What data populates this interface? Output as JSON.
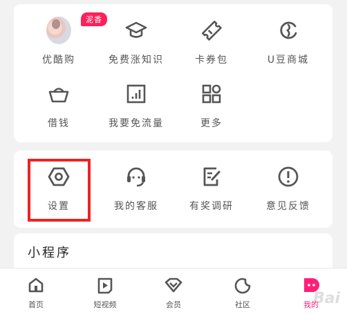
{
  "services": {
    "badge": "泥香",
    "items": [
      {
        "label": "优酷购",
        "icon": "avatar-image"
      },
      {
        "label": "免费涨知识",
        "icon": "graduation-cap-icon"
      },
      {
        "label": "卡券包",
        "icon": "ticket-icon"
      },
      {
        "label": "U豆商城",
        "icon": "u-bean-icon"
      },
      {
        "label": "借钱",
        "icon": "ingot-icon"
      },
      {
        "label": "我要免流量",
        "icon": "data-chart-icon"
      },
      {
        "label": "更多",
        "icon": "grid-icon"
      }
    ]
  },
  "tools": {
    "items": [
      {
        "label": "设置",
        "icon": "settings-hex-icon"
      },
      {
        "label": "我的客服",
        "icon": "headset-icon"
      },
      {
        "label": "有奖调研",
        "icon": "survey-pen-icon"
      },
      {
        "label": "意见反馈",
        "icon": "exclamation-icon"
      }
    ]
  },
  "mini_programs": {
    "title": "小程序"
  },
  "tabbar": {
    "items": [
      {
        "label": "首页",
        "icon": "home-icon"
      },
      {
        "label": "短视频",
        "icon": "play-icon"
      },
      {
        "label": "会员",
        "icon": "diamond-icon"
      },
      {
        "label": "社区",
        "icon": "community-icon"
      },
      {
        "label": "我的",
        "icon": "profile-face-icon",
        "active": true
      }
    ]
  },
  "watermark": "Bai",
  "colors": {
    "accent": "#ff1f7a",
    "badge": "#ff1f5a",
    "highlight": "#ee2222",
    "icon": "#555555"
  }
}
